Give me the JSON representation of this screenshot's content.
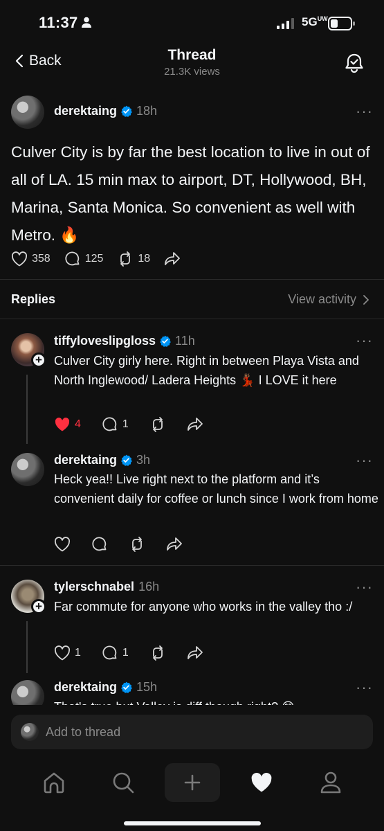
{
  "status": {
    "time": "11:37",
    "network": "5G",
    "network_suffix": "UW"
  },
  "header": {
    "back_label": "Back",
    "title": "Thread",
    "views": "21.3K views"
  },
  "post": {
    "username": "derektaing",
    "time": "18h",
    "text": "Culver City is by far the best location to live in out of all of LA. 15 min max to airport, DT, Hollywood, BH, Marina, Santa Monica. So convenient as well with Metro. 🔥",
    "likes": "358",
    "comments": "125",
    "reposts": "18"
  },
  "replies_header": {
    "label": "Replies",
    "view_activity": "View activity"
  },
  "replies": [
    {
      "username": "tiffyloveslipgloss",
      "time": "11h",
      "text": "Culver City girly here. Right in between Playa Vista and North Inglewood/ Ladera Heights 💃🏾 I LOVE it here",
      "likes": "4",
      "comments": "1",
      "reposts": ""
    },
    {
      "username": "derektaing",
      "time": "3h",
      "text": "Heck yea!! Live right next to the platform and it’s convenient daily for coffee or lunch since I work from home",
      "likes": "",
      "comments": "",
      "reposts": ""
    },
    {
      "username": "tylerschnabel",
      "time": "16h",
      "text": "Far commute for anyone who works in the valley tho :/",
      "likes": "1",
      "comments": "1",
      "reposts": ""
    },
    {
      "username": "derektaing",
      "time": "15h",
      "text": "That's true but Valley is diff though right? 😅"
    }
  ],
  "composer": {
    "placeholder": "Add to thread"
  },
  "colors": {
    "background": "#101010",
    "text": "#f3f5f7",
    "muted": "#8a8a8a",
    "verified": "#0095f6",
    "like_active": "#ff3040"
  }
}
